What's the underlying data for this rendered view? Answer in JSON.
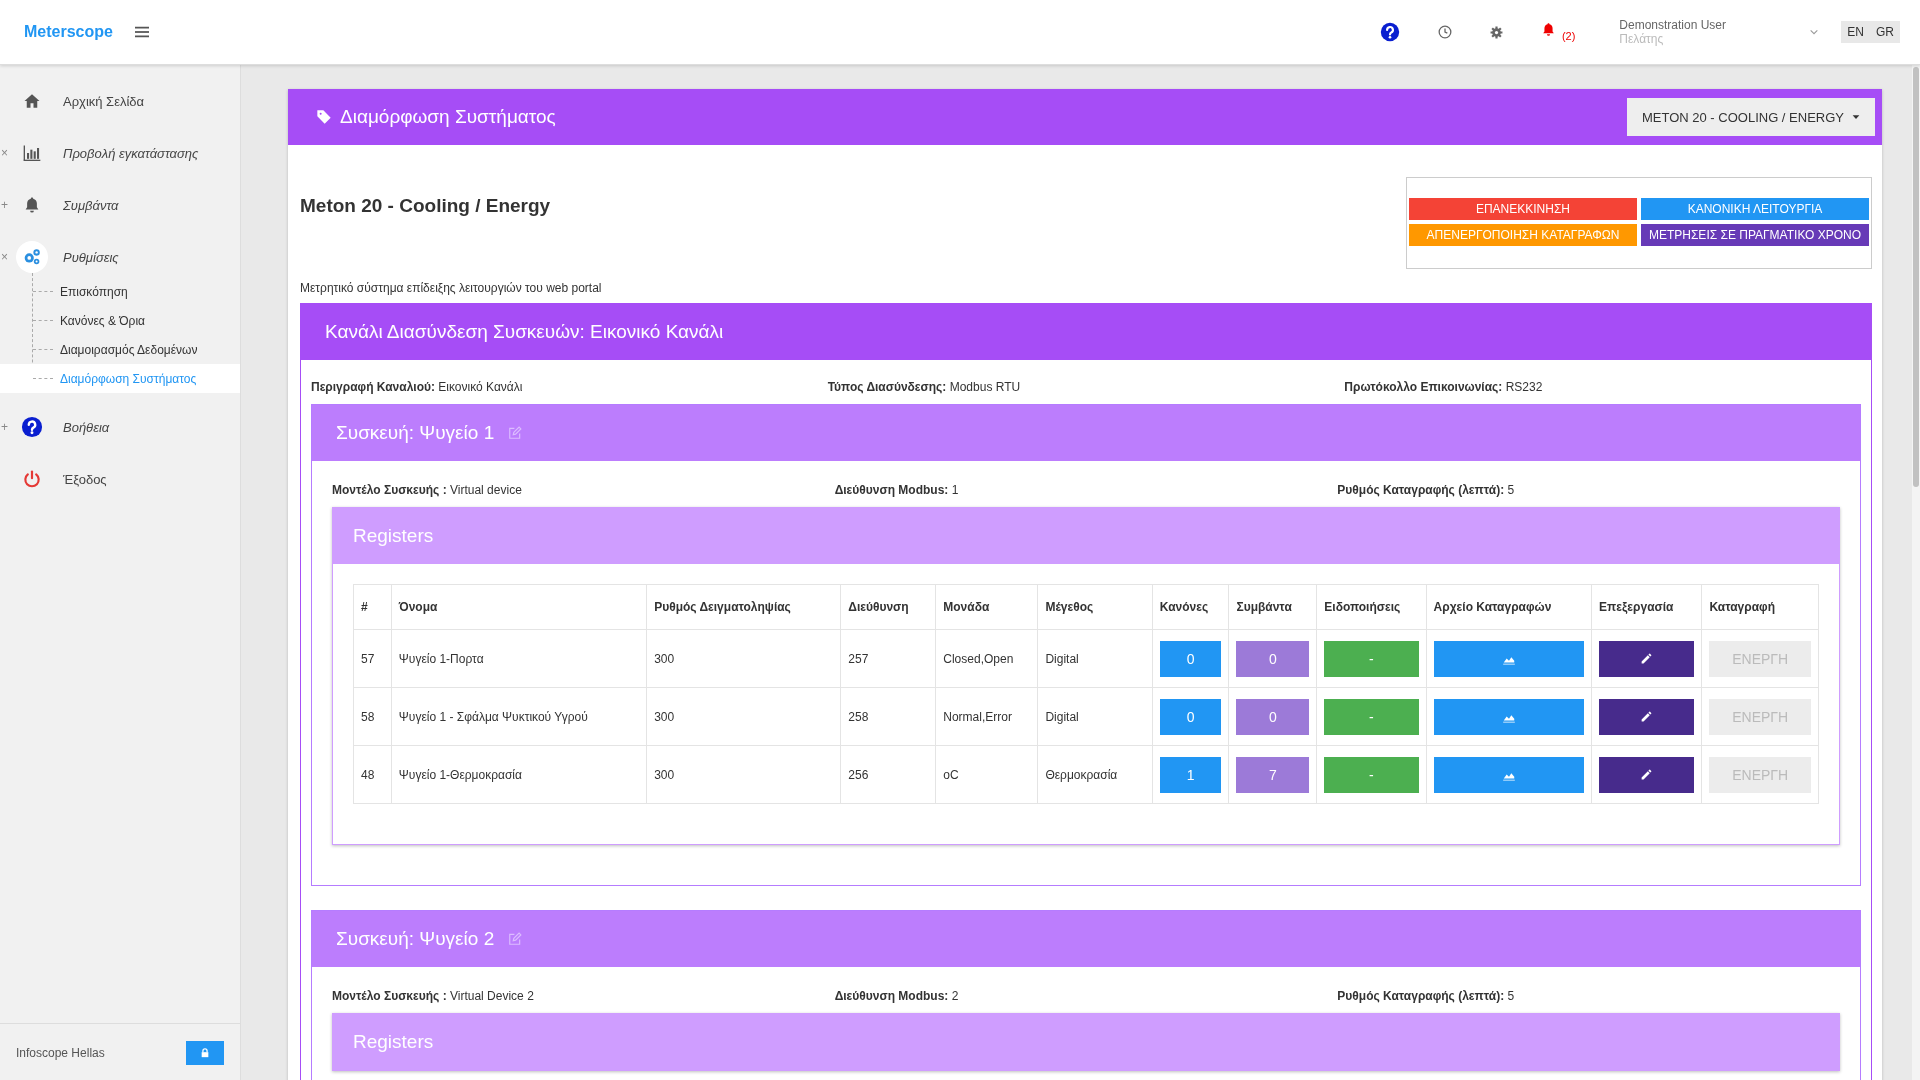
{
  "app": {
    "title": "Meterscope"
  },
  "topbar": {
    "notification_count": "(2)",
    "user": {
      "name": "Demonstration User",
      "role": "Πελάτης"
    },
    "languages": [
      "EN",
      "GR"
    ]
  },
  "sidebar": {
    "items": [
      {
        "label": "Αρχική Σελίδα",
        "selected": false
      },
      {
        "label": "Προβολή εγκατάστασης",
        "toggle": "×",
        "selected": false
      },
      {
        "label": "Συμβάντα",
        "toggle": "+",
        "selected": false
      },
      {
        "label": "Ρυθμίσεις",
        "toggle": "×",
        "selected": true,
        "children": [
          {
            "label": "Επισκόπηση",
            "selected": false
          },
          {
            "label": "Κανόνες & Όρια",
            "selected": false
          },
          {
            "label": "Διαμοιρασμός Δεδομένων",
            "selected": false
          },
          {
            "label": "Διαμόρφωση Συστήματος",
            "selected": true
          }
        ]
      },
      {
        "label": "Βοήθεια",
        "toggle": "+",
        "selected": false
      },
      {
        "label": "Έξοδος",
        "selected": false
      }
    ],
    "footer": "Infoscope Hellas"
  },
  "page": {
    "title": "Διαμόρφωση Συστήματος",
    "device_select": "METON 20 - COOLING / ENERGY",
    "system_name": "Meton 20 - Cooling / Energy",
    "description": "Μετρητικό σύστημα επίδειξης λειτουργιών του web portal",
    "actions": [
      {
        "label": "ΕΠΑΝΕΚΚΙΝΗΣΗ",
        "color": "#f44336"
      },
      {
        "label": "ΚΑΝΟΝΙΚΗ ΛΕΙΤΟΥΡΓΙΑ",
        "color": "#2196f3"
      },
      {
        "label": "ΑΠΕΝΕΡΓΟΠΟΙΗΣΗ ΚΑΤΑΓΡΑΦΩΝ",
        "color": "#ff9800"
      },
      {
        "label": "ΜΕΤΡΗΣΕΙΣ ΣΕ ΠΡΑΓΜΑΤΙΚΟ ΧΡΟΝΟ",
        "color": "#673ab7"
      }
    ]
  },
  "channel": {
    "title": "Κανάλι Διασύνδεση Συσκευών: Εικονικό Κανάλι",
    "fields": [
      {
        "label": "Περιγραφή Καναλιού:",
        "value": "Εικονικό Κανάλι"
      },
      {
        "label": "Τύπος Διασύνδεσης:",
        "value": "Modbus RTU"
      },
      {
        "label": "Πρωτόκολλο Επικοινωνίας:",
        "value": "RS232"
      }
    ],
    "devices": [
      {
        "title": "Συσκευή: Ψυγείο 1",
        "fields": [
          {
            "label": "Μοντέλο Συσκευής :",
            "value": "Virtual device"
          },
          {
            "label": "Διεύθυνση Modbus:",
            "value": "1"
          },
          {
            "label": "Ρυθμός Καταγραφής (λεπτά):",
            "value": "5"
          }
        ],
        "registers": {
          "title": "Registers",
          "columns": [
            "#",
            "Όνομα",
            "Ρυθμός Δειγματοληψίας",
            "Διεύθυνση",
            "Μονάδα",
            "Μέγεθος",
            "Κανόνες",
            "Συμβάντα",
            "Ειδοποιήσεις",
            "Αρχείο Καταγραφών",
            "Επεξεργασία",
            "Καταγραφή"
          ],
          "rows": [
            {
              "number": "57",
              "name": "Ψυγείο 1-Πορτα",
              "sample_rate": "300",
              "address": "257",
              "unit": "Closed,Open",
              "size": "Digital",
              "rules": "0",
              "events": "0",
              "alerts": "-",
              "logging": "ΕΝΕΡΓΗ"
            },
            {
              "number": "58",
              "name": "Ψυγείο 1 - Σφάλμα Ψυκτικού Υγρού",
              "sample_rate": "300",
              "address": "258",
              "unit": "Normal,Error",
              "size": "Digital",
              "rules": "0",
              "events": "0",
              "alerts": "-",
              "logging": "ΕΝΕΡΓΗ"
            },
            {
              "number": "48",
              "name": "Ψυγείο 1-Θερμοκρασία",
              "sample_rate": "300",
              "address": "256",
              "unit": "oC",
              "size": "Θερμοκρασία",
              "rules": "1",
              "events": "7",
              "alerts": "-",
              "logging": "ΕΝΕΡΓΗ"
            }
          ]
        }
      },
      {
        "title": "Συσκευή: Ψυγείο 2",
        "fields": [
          {
            "label": "Μοντέλο Συσκευής :",
            "value": "Virtual Device 2"
          },
          {
            "label": "Διεύθυνση Modbus:",
            "value": "2"
          },
          {
            "label": "Ρυθμός Καταγραφής (λεπτά):",
            "value": "5"
          }
        ],
        "registers": {
          "title": "Registers"
        }
      }
    ]
  }
}
